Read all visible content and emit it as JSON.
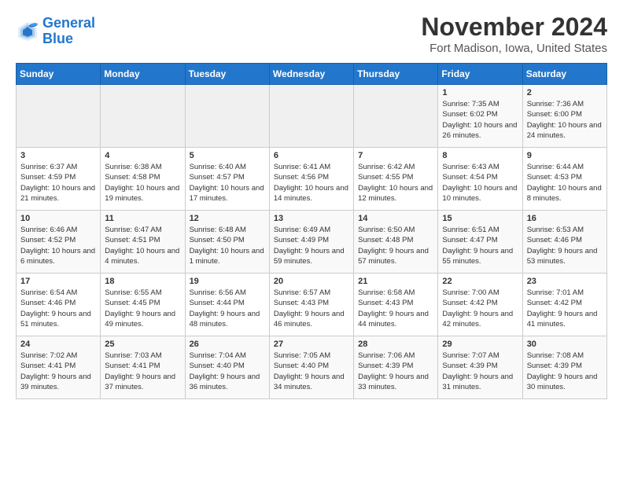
{
  "header": {
    "logo_line1": "General",
    "logo_line2": "Blue",
    "month": "November 2024",
    "location": "Fort Madison, Iowa, United States"
  },
  "weekdays": [
    "Sunday",
    "Monday",
    "Tuesday",
    "Wednesday",
    "Thursday",
    "Friday",
    "Saturday"
  ],
  "weeks": [
    [
      {
        "day": "",
        "info": ""
      },
      {
        "day": "",
        "info": ""
      },
      {
        "day": "",
        "info": ""
      },
      {
        "day": "",
        "info": ""
      },
      {
        "day": "",
        "info": ""
      },
      {
        "day": "1",
        "info": "Sunrise: 7:35 AM\nSunset: 6:02 PM\nDaylight: 10 hours and 26 minutes."
      },
      {
        "day": "2",
        "info": "Sunrise: 7:36 AM\nSunset: 6:00 PM\nDaylight: 10 hours and 24 minutes."
      }
    ],
    [
      {
        "day": "3",
        "info": "Sunrise: 6:37 AM\nSunset: 4:59 PM\nDaylight: 10 hours and 21 minutes."
      },
      {
        "day": "4",
        "info": "Sunrise: 6:38 AM\nSunset: 4:58 PM\nDaylight: 10 hours and 19 minutes."
      },
      {
        "day": "5",
        "info": "Sunrise: 6:40 AM\nSunset: 4:57 PM\nDaylight: 10 hours and 17 minutes."
      },
      {
        "day": "6",
        "info": "Sunrise: 6:41 AM\nSunset: 4:56 PM\nDaylight: 10 hours and 14 minutes."
      },
      {
        "day": "7",
        "info": "Sunrise: 6:42 AM\nSunset: 4:55 PM\nDaylight: 10 hours and 12 minutes."
      },
      {
        "day": "8",
        "info": "Sunrise: 6:43 AM\nSunset: 4:54 PM\nDaylight: 10 hours and 10 minutes."
      },
      {
        "day": "9",
        "info": "Sunrise: 6:44 AM\nSunset: 4:53 PM\nDaylight: 10 hours and 8 minutes."
      }
    ],
    [
      {
        "day": "10",
        "info": "Sunrise: 6:46 AM\nSunset: 4:52 PM\nDaylight: 10 hours and 6 minutes."
      },
      {
        "day": "11",
        "info": "Sunrise: 6:47 AM\nSunset: 4:51 PM\nDaylight: 10 hours and 4 minutes."
      },
      {
        "day": "12",
        "info": "Sunrise: 6:48 AM\nSunset: 4:50 PM\nDaylight: 10 hours and 1 minute."
      },
      {
        "day": "13",
        "info": "Sunrise: 6:49 AM\nSunset: 4:49 PM\nDaylight: 9 hours and 59 minutes."
      },
      {
        "day": "14",
        "info": "Sunrise: 6:50 AM\nSunset: 4:48 PM\nDaylight: 9 hours and 57 minutes."
      },
      {
        "day": "15",
        "info": "Sunrise: 6:51 AM\nSunset: 4:47 PM\nDaylight: 9 hours and 55 minutes."
      },
      {
        "day": "16",
        "info": "Sunrise: 6:53 AM\nSunset: 4:46 PM\nDaylight: 9 hours and 53 minutes."
      }
    ],
    [
      {
        "day": "17",
        "info": "Sunrise: 6:54 AM\nSunset: 4:46 PM\nDaylight: 9 hours and 51 minutes."
      },
      {
        "day": "18",
        "info": "Sunrise: 6:55 AM\nSunset: 4:45 PM\nDaylight: 9 hours and 49 minutes."
      },
      {
        "day": "19",
        "info": "Sunrise: 6:56 AM\nSunset: 4:44 PM\nDaylight: 9 hours and 48 minutes."
      },
      {
        "day": "20",
        "info": "Sunrise: 6:57 AM\nSunset: 4:43 PM\nDaylight: 9 hours and 46 minutes."
      },
      {
        "day": "21",
        "info": "Sunrise: 6:58 AM\nSunset: 4:43 PM\nDaylight: 9 hours and 44 minutes."
      },
      {
        "day": "22",
        "info": "Sunrise: 7:00 AM\nSunset: 4:42 PM\nDaylight: 9 hours and 42 minutes."
      },
      {
        "day": "23",
        "info": "Sunrise: 7:01 AM\nSunset: 4:42 PM\nDaylight: 9 hours and 41 minutes."
      }
    ],
    [
      {
        "day": "24",
        "info": "Sunrise: 7:02 AM\nSunset: 4:41 PM\nDaylight: 9 hours and 39 minutes."
      },
      {
        "day": "25",
        "info": "Sunrise: 7:03 AM\nSunset: 4:41 PM\nDaylight: 9 hours and 37 minutes."
      },
      {
        "day": "26",
        "info": "Sunrise: 7:04 AM\nSunset: 4:40 PM\nDaylight: 9 hours and 36 minutes."
      },
      {
        "day": "27",
        "info": "Sunrise: 7:05 AM\nSunset: 4:40 PM\nDaylight: 9 hours and 34 minutes."
      },
      {
        "day": "28",
        "info": "Sunrise: 7:06 AM\nSunset: 4:39 PM\nDaylight: 9 hours and 33 minutes."
      },
      {
        "day": "29",
        "info": "Sunrise: 7:07 AM\nSunset: 4:39 PM\nDaylight: 9 hours and 31 minutes."
      },
      {
        "day": "30",
        "info": "Sunrise: 7:08 AM\nSunset: 4:39 PM\nDaylight: 9 hours and 30 minutes."
      }
    ]
  ]
}
